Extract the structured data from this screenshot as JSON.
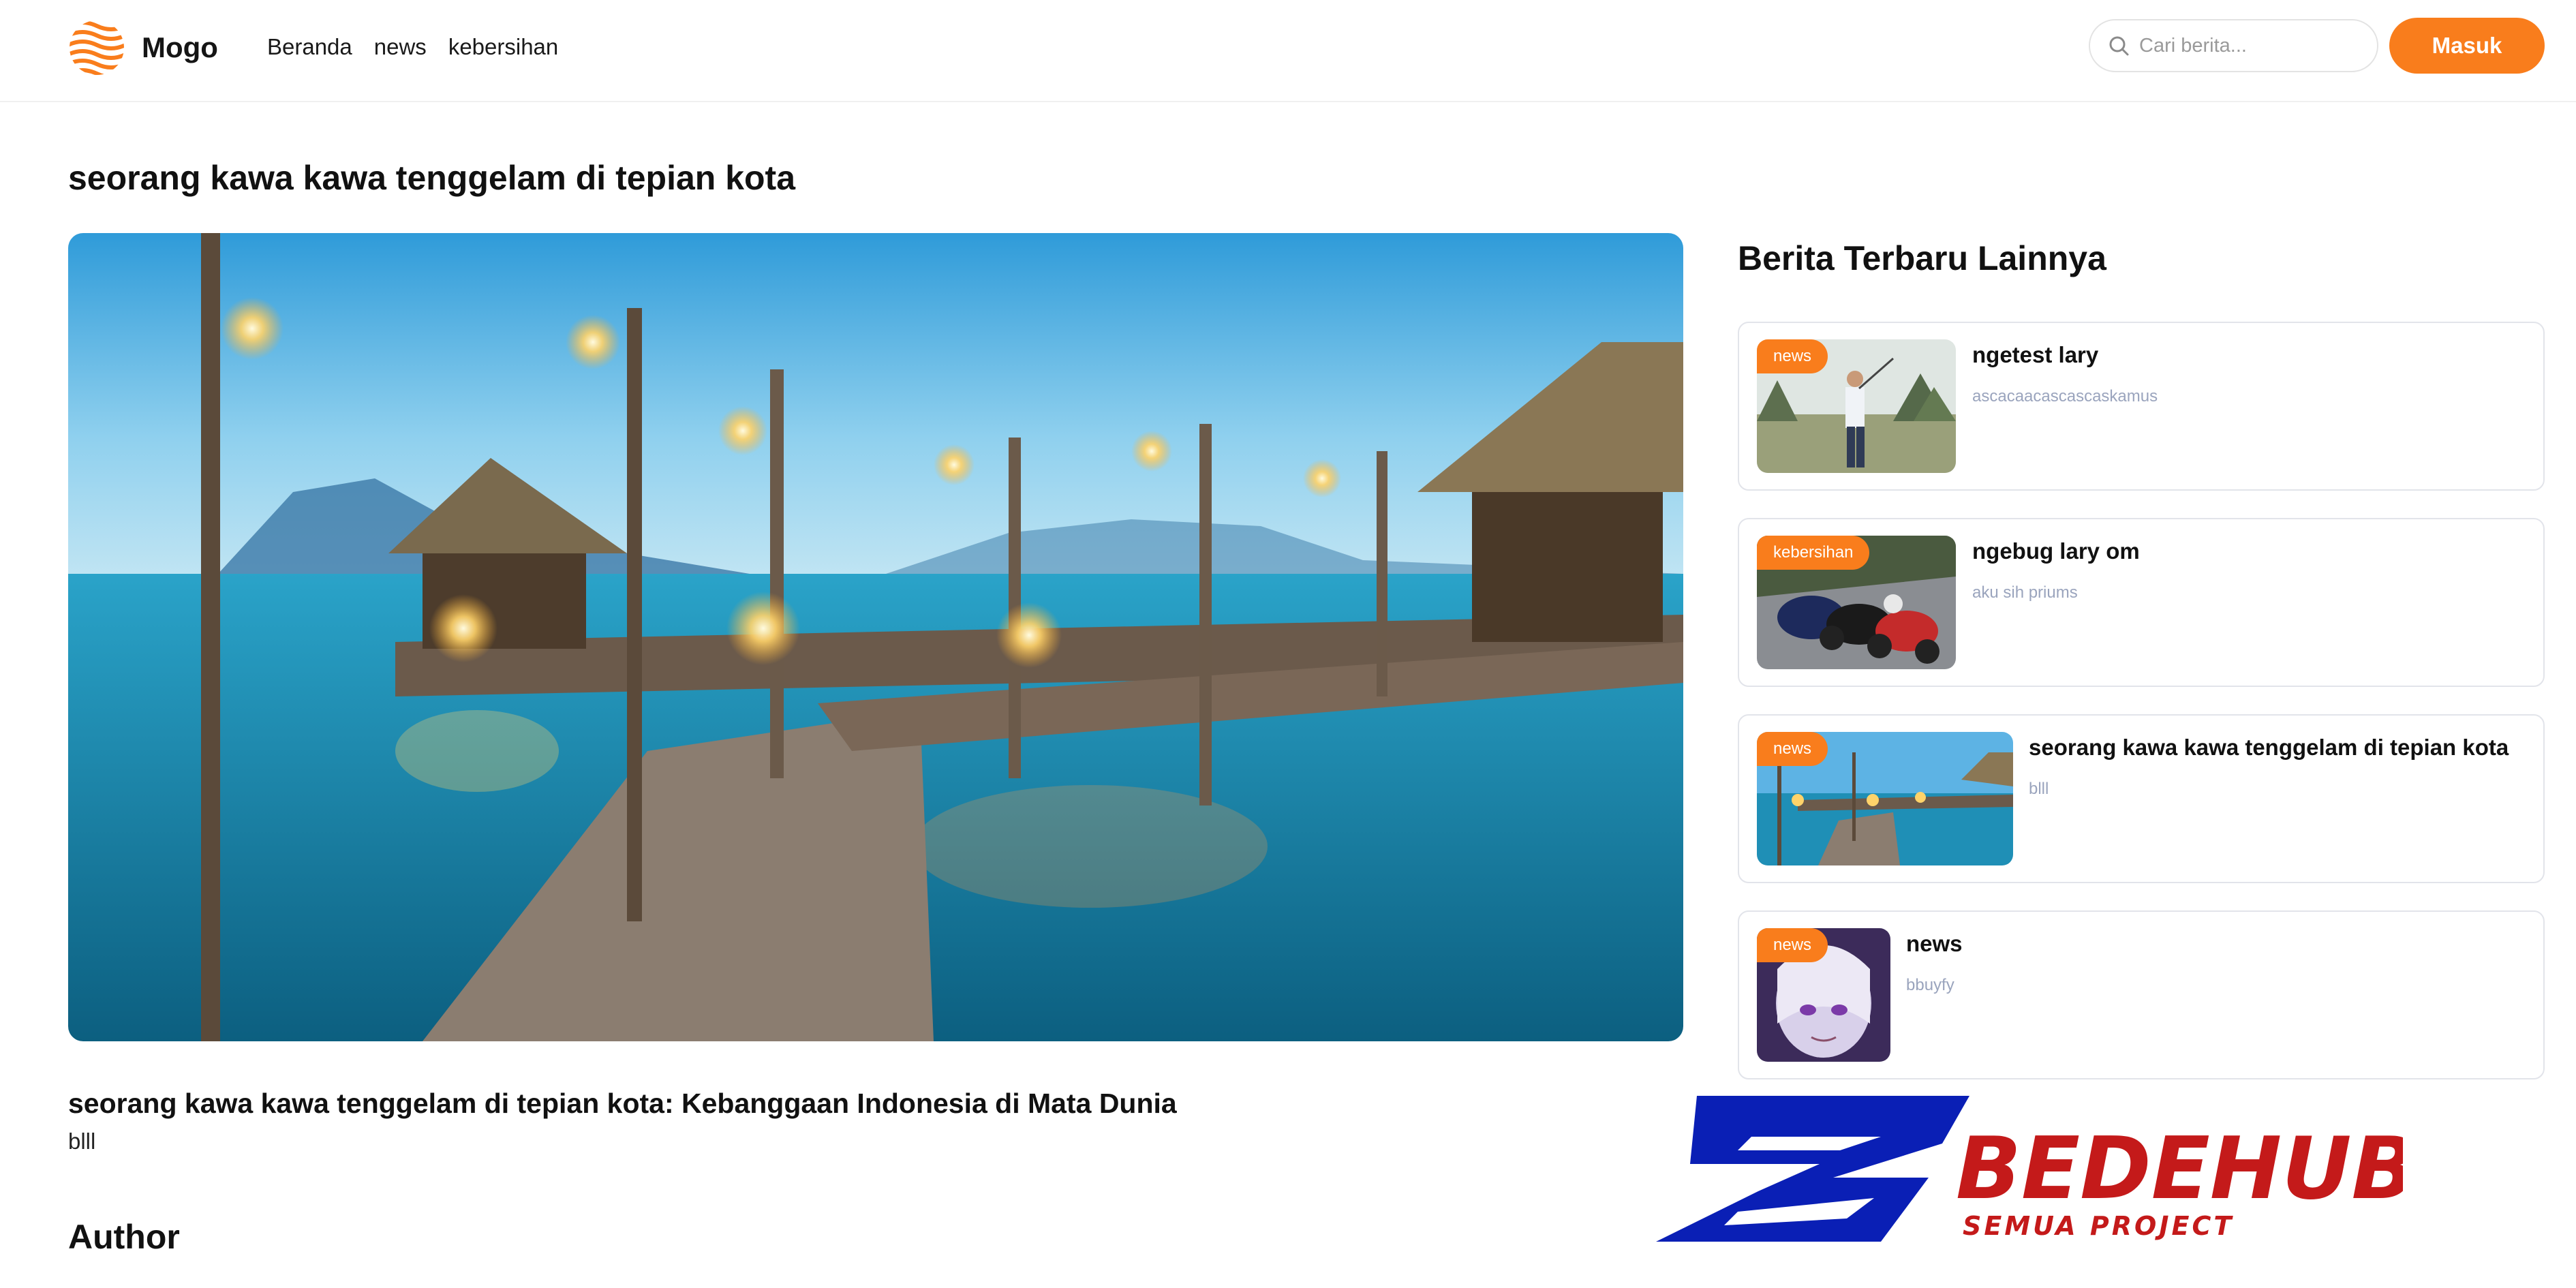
{
  "brand": {
    "name": "Mogo",
    "accent": "#f97d1c"
  },
  "nav": {
    "links": [
      {
        "label": "Beranda"
      },
      {
        "label": "news"
      },
      {
        "label": "kebersihan"
      }
    ]
  },
  "search": {
    "placeholder": "Cari berita...",
    "value": "",
    "icon": "search-icon"
  },
  "auth": {
    "login_label": "Masuk"
  },
  "article": {
    "title": "seorang kawa kawa tenggelam di tepian kota",
    "subtitle": "seorang kawa kawa tenggelam di tepian kota: Kebanggaan Indonesia di Mata Dunia",
    "body": "blll",
    "author_heading": "Author"
  },
  "sidebar": {
    "title": "Berita Terbaru Lainnya",
    "items": [
      {
        "category": "news",
        "title": "ngetest lary",
        "desc": "ascacaacascascaskamus",
        "thumb": "golfer-photo"
      },
      {
        "category": "kebersihan",
        "title": "ngebug lary om",
        "desc": "aku sih priums",
        "thumb": "motorcycle-race-photo"
      },
      {
        "category": "news",
        "title": "seorang kawa kawa tenggelam di tepian kota",
        "desc": "blll",
        "thumb": "pier-photo"
      },
      {
        "category": "news",
        "title": "news",
        "desc": "bbuyfy",
        "thumb": "anime-character-art"
      }
    ]
  },
  "watermark": {
    "title": "BEDEHUB",
    "tagline": "SEMUA PROJECT"
  }
}
